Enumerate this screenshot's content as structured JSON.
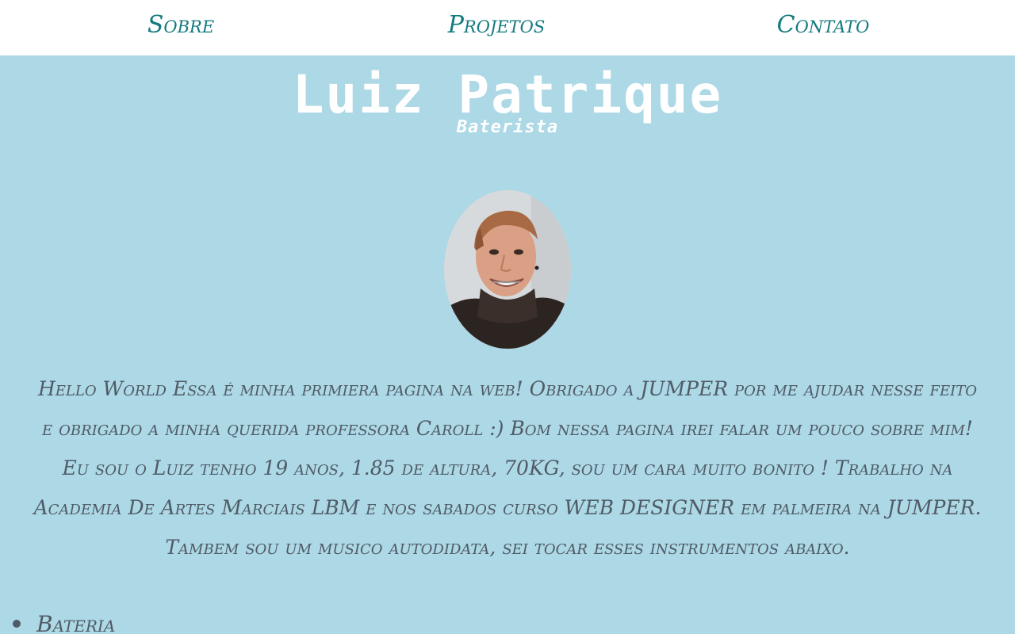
{
  "nav": {
    "items": [
      {
        "label": "Sobre"
      },
      {
        "label": "Projetos"
      },
      {
        "label": "Contato"
      }
    ]
  },
  "header": {
    "title": "Luiz Patrique",
    "subtitle": "Baterista"
  },
  "profile": {
    "image": "profile-photo"
  },
  "bio": {
    "text": "Hello World Essa é minha primiera pagina na web! Obrigado a JUMPER por me ajudar nesse feito e obrigado a minha querida professora Caroll :) Bom nessa pagina irei falar um pouco sobre mim! Eu sou o Luiz tenho 19 anos, 1.85 de altura, 70KG, sou um cara muito bonito ! Trabalho na Academia De Artes Marciais LBM e nos sabados curso WEB DESIGNER em palmeira na JUMPER. Tambem sou um musico autodidata, sei tocar esses instrumentos abaixo."
  },
  "instruments": {
    "items": [
      {
        "label": "Bateria"
      }
    ]
  },
  "colors": {
    "background": "#add8e6",
    "navbar": "#ffffff",
    "nav_link": "#137a7f",
    "text": "#4f5b66",
    "title": "#ffffff"
  }
}
